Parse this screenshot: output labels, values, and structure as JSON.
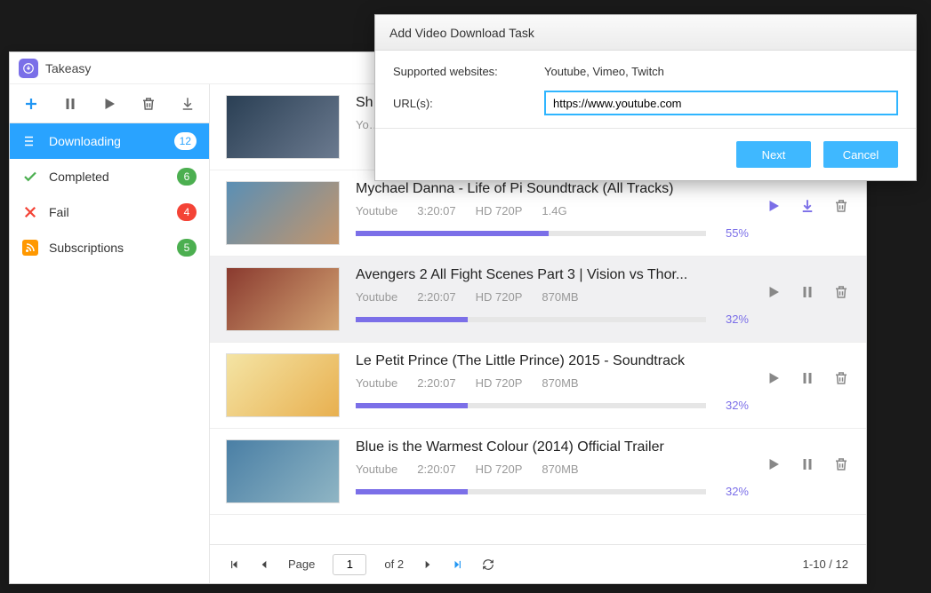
{
  "app": {
    "title": "Takeasy"
  },
  "toolbar": {
    "add": "add",
    "pause": "pause",
    "play": "play",
    "delete": "delete",
    "download": "download"
  },
  "sidebar": {
    "items": [
      {
        "label": "Downloading",
        "badge": "12",
        "icon": "downloading",
        "active": true,
        "badgeClass": ""
      },
      {
        "label": "Completed",
        "badge": "6",
        "icon": "check",
        "active": false,
        "badgeClass": "green"
      },
      {
        "label": "Fail",
        "badge": "4",
        "icon": "x",
        "active": false,
        "badgeClass": "red"
      },
      {
        "label": "Subscriptions",
        "badge": "5",
        "icon": "rss",
        "active": false,
        "badgeClass": "green"
      }
    ]
  },
  "downloads": [
    {
      "title": "Sh…",
      "source": "Yo…",
      "duration": "",
      "quality": "",
      "size": "",
      "percent": 0,
      "selected": false,
      "accent": false,
      "thumb": "t1"
    },
    {
      "title": "Mychael Danna - Life of Pi Soundtrack (All Tracks)",
      "source": "Youtube",
      "duration": "3:20:07",
      "quality": "HD 720P",
      "size": "1.4G",
      "percent": 55,
      "selected": false,
      "accent": true,
      "thumb": "t2"
    },
    {
      "title": "Avengers 2 All Fight Scenes Part 3 | Vision vs  Thor...",
      "source": "Youtube",
      "duration": "2:20:07",
      "quality": "HD 720P",
      "size": "870MB",
      "percent": 32,
      "selected": true,
      "accent": false,
      "thumb": "t3"
    },
    {
      "title": "Le Petit Prince (The Little Prince) 2015 - Soundtrack",
      "source": "Youtube",
      "duration": "2:20:07",
      "quality": "HD 720P",
      "size": "870MB",
      "percent": 32,
      "selected": false,
      "accent": false,
      "thumb": "t4"
    },
    {
      "title": "Blue is the Warmest Colour (2014) Official Trailer",
      "source": "Youtube",
      "duration": "2:20:07",
      "quality": "HD 720P",
      "size": "870MB",
      "percent": 32,
      "selected": false,
      "accent": false,
      "thumb": "t5"
    }
  ],
  "pagination": {
    "page_label": "Page",
    "current": "1",
    "of_label": "of",
    "total_pages": "2",
    "range": "1-10 / 12"
  },
  "dialog": {
    "title": "Add Video Download Task",
    "supported_label": "Supported websites:",
    "supported_value": "Youtube, Vimeo, Twitch",
    "url_label": "URL(s):",
    "url_value": "https://www.youtube.com",
    "next": "Next",
    "cancel": "Cancel"
  }
}
